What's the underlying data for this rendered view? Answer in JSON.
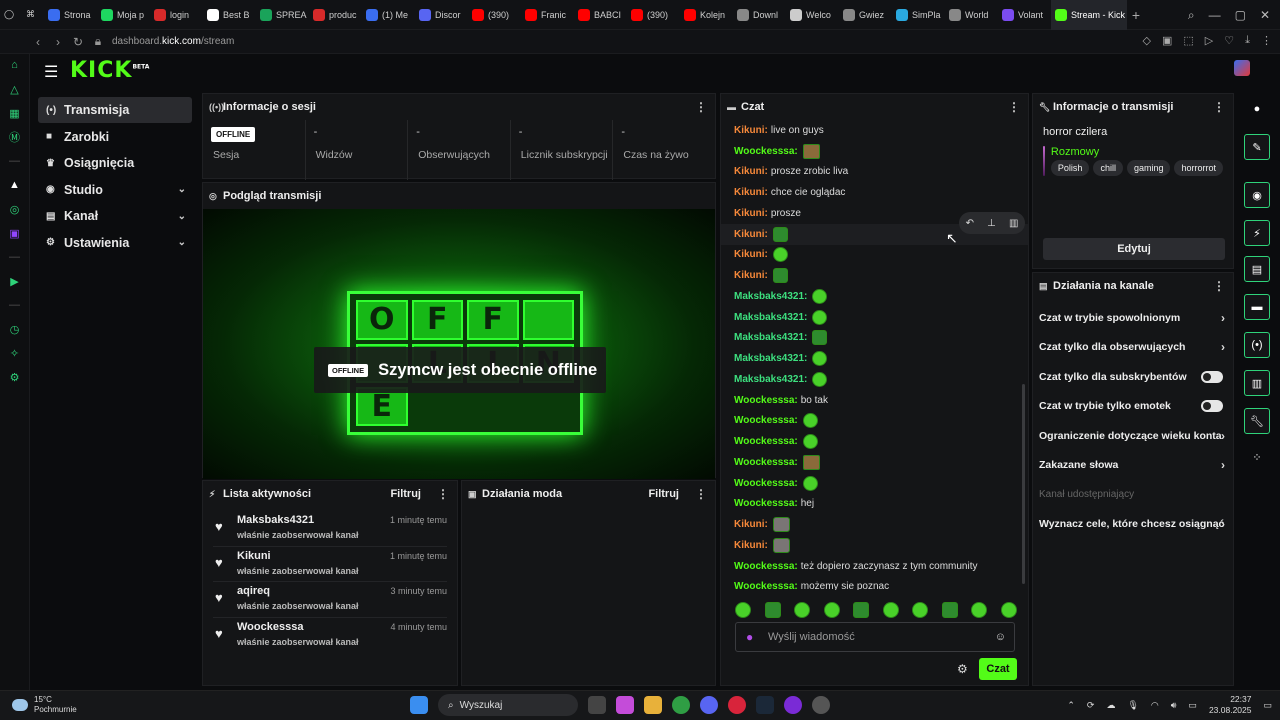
{
  "browser": {
    "tabs": [
      {
        "label": "Strona",
        "color": "#3a6df0"
      },
      {
        "label": "Moja p",
        "color": "#1ed760"
      },
      {
        "label": "login",
        "color": "#d82a2a"
      },
      {
        "label": "Best B",
        "color": "#ffffff"
      },
      {
        "label": "SPREA",
        "color": "#1aa35a"
      },
      {
        "label": "produc",
        "color": "#d82a2a"
      },
      {
        "label": "(1) Me",
        "color": "#3a6df0"
      },
      {
        "label": "Discor",
        "color": "#5865f2"
      },
      {
        "label": "(390)",
        "color": "#ff0000"
      },
      {
        "label": "Franic",
        "color": "#ff0000"
      },
      {
        "label": "BABCI",
        "color": "#ff0000"
      },
      {
        "label": "(390)",
        "color": "#ff0000"
      },
      {
        "label": "Kolejn",
        "color": "#ff0000"
      },
      {
        "label": "Downl",
        "color": "#888888"
      },
      {
        "label": "Welco",
        "color": "#cccccc"
      },
      {
        "label": "Gwiez",
        "color": "#888888"
      },
      {
        "label": "SimPla",
        "color": "#2aa9e0"
      },
      {
        "label": "World",
        "color": "#888888"
      },
      {
        "label": "Volant",
        "color": "#7b4cf0"
      }
    ],
    "active_tab": "Stream - Kick",
    "url_prefix": "dashboard.",
    "url_domain": "kick.com",
    "url_path": "/stream"
  },
  "header": {
    "logo": "KICK",
    "logo_sup": "BETA"
  },
  "nav": [
    {
      "label": "Transmisja",
      "icon": "(•)",
      "active": true,
      "chev": ""
    },
    {
      "label": "Zarobki",
      "icon": "■",
      "active": false,
      "chev": ""
    },
    {
      "label": "Osiągnięcia",
      "icon": "♛",
      "active": false,
      "chev": ""
    },
    {
      "label": "Studio",
      "icon": "◉",
      "active": false,
      "chev": "⌄"
    },
    {
      "label": "Kanał",
      "icon": "▤",
      "active": false,
      "chev": "⌄"
    },
    {
      "label": "Ustawienia",
      "icon": "⚙",
      "active": false,
      "chev": "⌄"
    }
  ],
  "session": {
    "title": "Informacje o sesji",
    "badge": "OFFLINE",
    "stats": [
      {
        "value": "",
        "label": "Sesja"
      },
      {
        "value": "-",
        "label": "Widzów"
      },
      {
        "value": "-",
        "label": "Obserwujących"
      },
      {
        "value": "-",
        "label": "Licznik subskrypcji"
      },
      {
        "value": "-",
        "label": "Czas na żywo"
      }
    ]
  },
  "preview": {
    "title": "Podgląd transmisji",
    "sign": [
      "O",
      "F",
      "F",
      "",
      "",
      "L",
      "I",
      "N",
      "E"
    ],
    "badge": "OFFLINE",
    "message": "Szymcw jest obecnie offline"
  },
  "activity": {
    "title": "Lista aktywności",
    "filter": "Filtruj",
    "items": [
      {
        "name": "Maksbaks4321",
        "desc": "właśnie zaobserwował kanał",
        "time": "1 minutę temu"
      },
      {
        "name": "Kikuni",
        "desc": "właśnie zaobserwował kanał",
        "time": "1 minutę temu"
      },
      {
        "name": "aqireq",
        "desc": "właśnie zaobserwował kanał",
        "time": "3 minuty temu"
      },
      {
        "name": "Woockesssa",
        "desc": "właśnie zaobserwował kanał",
        "time": "4 minuty temu"
      }
    ]
  },
  "modactions": {
    "title": "Działania moda",
    "filter": "Filtruj"
  },
  "chat": {
    "title": "Czat",
    "messages": [
      {
        "user": "Kikuni:",
        "cls": "k",
        "text": "live on guys",
        "emo": ""
      },
      {
        "user": "Woockesssa:",
        "cls": "w",
        "text": "",
        "emo": "br"
      },
      {
        "user": "Kikuni:",
        "cls": "k",
        "text": "prosze zrobic liva",
        "emo": ""
      },
      {
        "user": "Kikuni:",
        "cls": "k",
        "text": "chce cie oglądac",
        "emo": ""
      },
      {
        "user": "Kikuni:",
        "cls": "k",
        "text": "prosze",
        "emo": ""
      },
      {
        "user": "Kikuni:",
        "cls": "k",
        "text": "",
        "emo": "sq"
      },
      {
        "user": "Kikuni:",
        "cls": "k",
        "text": "",
        "emo": "g"
      },
      {
        "user": "Kikuni:",
        "cls": "k",
        "text": "",
        "emo": "sq"
      },
      {
        "user": "Maksbaks4321:",
        "cls": "m",
        "text": "",
        "emo": "g"
      },
      {
        "user": "Maksbaks4321:",
        "cls": "m",
        "text": "",
        "emo": "g"
      },
      {
        "user": "Maksbaks4321:",
        "cls": "m",
        "text": "",
        "emo": "sq"
      },
      {
        "user": "Maksbaks4321:",
        "cls": "m",
        "text": "",
        "emo": "g"
      },
      {
        "user": "Maksbaks4321:",
        "cls": "m",
        "text": "",
        "emo": "g"
      },
      {
        "user": "Woockesssa:",
        "cls": "w",
        "text": "bo tak",
        "emo": ""
      },
      {
        "user": "Woockesssa:",
        "cls": "w",
        "text": "",
        "emo": "g"
      },
      {
        "user": "Woockesssa:",
        "cls": "w",
        "text": "",
        "emo": "g"
      },
      {
        "user": "Woockesssa:",
        "cls": "w",
        "text": "",
        "emo": "br"
      },
      {
        "user": "Woockesssa:",
        "cls": "w",
        "text": "",
        "emo": "g"
      },
      {
        "user": "Woockesssa:",
        "cls": "w",
        "text": "hej",
        "emo": ""
      },
      {
        "user": "Kikuni:",
        "cls": "k",
        "text": "",
        "emo": "gr"
      },
      {
        "user": "Kikuni:",
        "cls": "k",
        "text": "",
        "emo": "gr"
      },
      {
        "user": "Woockesssa:",
        "cls": "w",
        "text": "też dopiero zaczynasz z tym community",
        "emo": ""
      },
      {
        "user": "Woockesssa:",
        "cls": "w",
        "text": "możemy sie poznac",
        "emo": ""
      }
    ],
    "highlight_index": 5,
    "emote_bar_count": 10,
    "placeholder": "Wyślij wiadomość",
    "send_label": "Czat"
  },
  "streaminfo": {
    "title": "Informacje o transmisji",
    "stream_title": "horror czilera",
    "category": "Rozmowy",
    "tags": [
      "Polish",
      "chill",
      "gaming",
      "horrorrot"
    ],
    "edit_label": "Edytuj"
  },
  "channel": {
    "title": "Działania na kanale",
    "items": [
      {
        "label": "Czat w trybie spowolnionym",
        "type": "arrow"
      },
      {
        "label": "Czat tylko dla obserwujących",
        "type": "arrow"
      },
      {
        "label": "Czat tylko dla subskrybentów",
        "type": "toggle"
      },
      {
        "label": "Czat w trybie tylko emotek",
        "type": "toggle"
      },
      {
        "label": "Ograniczenie dotyczące wieku konta",
        "type": "arrow"
      },
      {
        "label": "Zakazane słowa",
        "type": "arrow"
      },
      {
        "label": "Kanał udostępniający",
        "type": "disabled"
      },
      {
        "label": "Wyznacz cele, które chcesz osiągnąć",
        "type": "arrow"
      }
    ]
  },
  "taskbar": {
    "temp": "15°C",
    "weather": "Pochmurnie",
    "search": "Wyszukaj",
    "time": "22:37",
    "date": "23.08.2025"
  }
}
